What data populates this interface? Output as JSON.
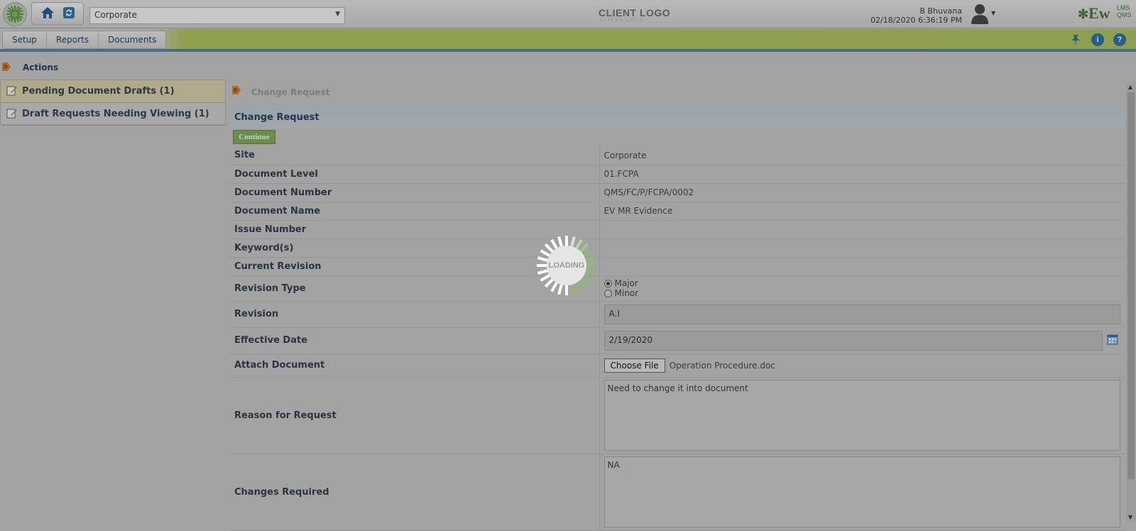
{
  "header": {
    "site_select_value": "Corporate",
    "client_logo": "CLIENT LOGO",
    "client_logo_sub": "CLIENT LOGO",
    "user_name": "B Bhuvana",
    "user_datetime": "02/18/2020 6:36:19 PM",
    "brand_main": "Ew",
    "brand_sup_top": "LMS",
    "brand_sup_bottom": "QMS",
    "icons": [
      "app-logo-icon",
      "home-icon",
      "refresh-icon",
      "user-avatar-icon",
      "pin-icon",
      "info-icon",
      "help-icon"
    ]
  },
  "menu": {
    "tabs": [
      {
        "label": "Setup"
      },
      {
        "label": "Reports"
      },
      {
        "label": "Documents"
      }
    ]
  },
  "breadcrumb": {
    "label": "Actions"
  },
  "sidebar": {
    "items": [
      {
        "label": "Pending Document Drafts (1)"
      },
      {
        "label": "Draft Requests Needing Viewing (1)"
      }
    ]
  },
  "main": {
    "breadcrumb": "Change Request",
    "section_title": "Change Request",
    "continue_label": "Continue",
    "fields": {
      "site": {
        "label": "Site",
        "value": "Corporate"
      },
      "document_level": {
        "label": "Document Level",
        "value": "01.FCPA"
      },
      "document_number": {
        "label": "Document Number",
        "value": "QMS/FC/P/FCPA/0002"
      },
      "document_name": {
        "label": "Document Name",
        "value": "EV MR Evidence"
      },
      "issue_number": {
        "label": "Issue Number",
        "value": ""
      },
      "keywords": {
        "label": "Keyword(s)",
        "value": ""
      },
      "current_revision": {
        "label": "Current Revision",
        "value": ""
      },
      "revision_type": {
        "label": "Revision Type",
        "option1": "Major",
        "option2": "Minor",
        "selected": "Major"
      },
      "revision": {
        "label": "Revision",
        "value": "A.I"
      },
      "effective_date": {
        "label": "Effective Date",
        "value": "2/19/2020"
      },
      "attach_document": {
        "label": "Attach Document",
        "button": "Choose File",
        "file_name": "Operation Procedure.doc"
      },
      "reason": {
        "label": "Reason for Request",
        "value": "Need to change it into document"
      },
      "changes": {
        "label": "Changes Required",
        "value": "NA"
      }
    }
  },
  "loading": {
    "label": "LOADING"
  },
  "colors": {
    "accent_green": "#8f9f50",
    "nav_blue": "#21364f",
    "loader_green": "#8fb874"
  }
}
